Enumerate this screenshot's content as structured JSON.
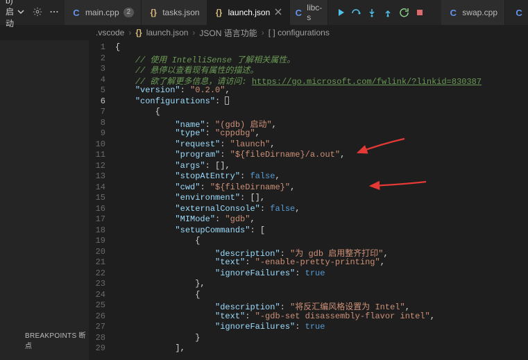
{
  "toolbar": {
    "launch_label": "b) 启动",
    "gear_tip": "settings",
    "more_tip": "more"
  },
  "tabs": [
    {
      "icon": "cpp",
      "label": "main.cpp",
      "badge": "2",
      "active": false
    },
    {
      "icon": "json",
      "label": "tasks.json",
      "badge": "",
      "active": false
    },
    {
      "icon": "json",
      "label": "launch.json",
      "badge": "",
      "active": true
    },
    {
      "icon": "c",
      "label": "libc-s",
      "badge": "",
      "active": false,
      "narrow": true
    },
    {
      "icon": "cpp",
      "label": "swap.cpp",
      "badge": "",
      "active": false
    },
    {
      "icon": "c",
      "label": "",
      "badge": "",
      "active": false,
      "tail": true
    }
  ],
  "breadcrumb": {
    "a": ".vscode",
    "b": "launch.json",
    "c": "JSON 语言功能",
    "d": "[ ] configurations"
  },
  "sidebar": {
    "breakpoints": "BREAKPOINTS 断点"
  },
  "code": {
    "c2a": "// 使用 IntelliSense 了解相关属性。",
    "c3a": "// 悬停以查看现有属性的描述。",
    "c4a": "// 欲了解更多信息，请访问: ",
    "c4b": "https://go.microsoft.com/fwlink/?linkid=830387",
    "k_version": "\"version\"",
    "v_version": "\"0.2.0\"",
    "k_configs": "\"configurations\"",
    "k_name": "\"name\"",
    "v_name": "\"(gdb) 启动\"",
    "k_type": "\"type\"",
    "v_type": "\"cppdbg\"",
    "k_request": "\"request\"",
    "v_request": "\"launch\"",
    "k_program": "\"program\"",
    "v_program": "\"${fileDirname}/a.out\"",
    "k_args": "\"args\"",
    "k_stop": "\"stopAtEntry\"",
    "k_cwd": "\"cwd\"",
    "v_cwd": "\"${fileDirname}\"",
    "k_env": "\"environment\"",
    "k_extc": "\"externalConsole\"",
    "k_mimode": "\"MIMode\"",
    "v_mimode": "\"gdb\"",
    "k_setup": "\"setupCommands\"",
    "k_desc": "\"description\"",
    "v_desc1": "\"为 gdb 启用整齐打印\"",
    "k_text": "\"text\"",
    "v_text1": "\"-enable-pretty-printing\"",
    "k_ign": "\"ignoreFailures\"",
    "v_desc2": "\"将反汇编风格设置为 Intel\"",
    "v_text2": "\"-gdb-set disassembly-flavor intel\"",
    "false": "false",
    "true": "true"
  }
}
